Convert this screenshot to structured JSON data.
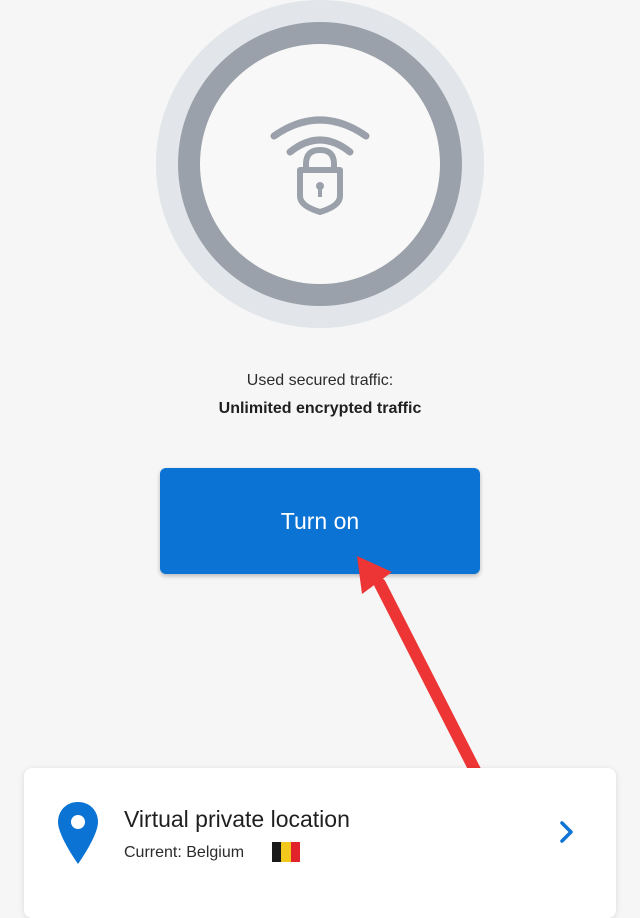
{
  "status": {
    "traffic_label": "Used secured traffic:",
    "traffic_value": "Unlimited encrypted traffic"
  },
  "actions": {
    "turn_on_label": "Turn on"
  },
  "location": {
    "title": "Virtual private location",
    "current_text": "Current: Belgium",
    "flag_colors": [
      "#1a1a1a",
      "#f2c81c",
      "#e1232b"
    ]
  },
  "icons": {
    "shield": "wifi-lock-icon",
    "pin": "location-pin-icon",
    "flag": "belgium-flag-icon",
    "chevron": "chevron-right-icon"
  },
  "colors": {
    "accent": "#0a73d3",
    "annotation": "#ee3535",
    "ring_outer": "#e2e5e9",
    "ring_mid": "#9aa1aa",
    "icon_gray": "#9aa1aa"
  }
}
